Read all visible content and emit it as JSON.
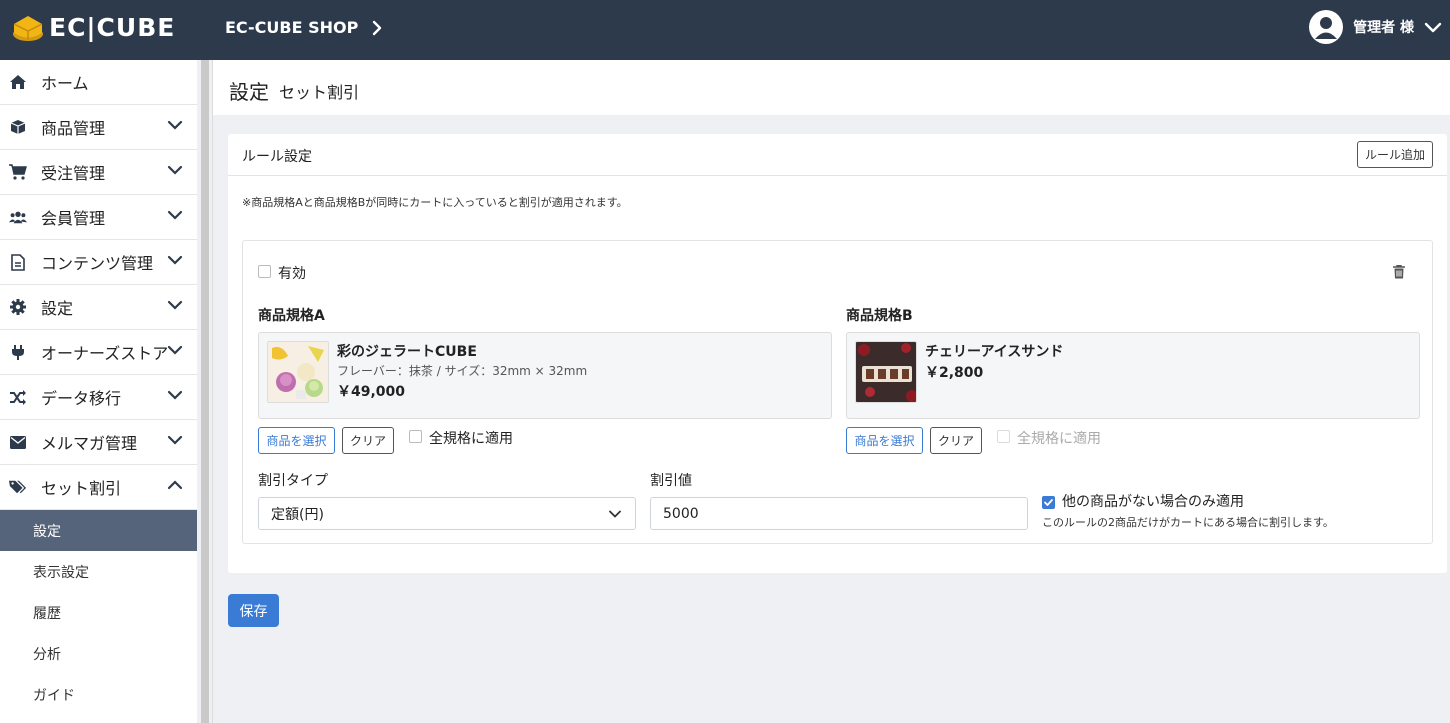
{
  "header": {
    "logo_text": "EC|CUBE",
    "shop_name": "EC-CUBE SHOP",
    "user_label": "管理者 様"
  },
  "sidebar": {
    "items": [
      {
        "label": "ホーム",
        "icon": "home-icon"
      },
      {
        "label": "商品管理",
        "icon": "box-icon"
      },
      {
        "label": "受注管理",
        "icon": "cart-icon"
      },
      {
        "label": "会員管理",
        "icon": "users-icon"
      },
      {
        "label": "コンテンツ管理",
        "icon": "file-icon"
      },
      {
        "label": "設定",
        "icon": "gear-icon"
      },
      {
        "label": "オーナーズストア",
        "icon": "plug-icon"
      },
      {
        "label": "データ移行",
        "icon": "shuffle-icon"
      },
      {
        "label": "メルマガ管理",
        "icon": "envelope-icon"
      },
      {
        "label": "セット割引",
        "icon": "tags-icon"
      }
    ],
    "sub_items": [
      {
        "label": "設定",
        "active": true
      },
      {
        "label": "表示設定"
      },
      {
        "label": "履歴"
      },
      {
        "label": "分析"
      },
      {
        "label": "ガイド"
      }
    ]
  },
  "page": {
    "title": "設定",
    "subtitle": "セット割引"
  },
  "card": {
    "title": "ルール設定",
    "add_rule_label": "ルール追加",
    "note": "※商品規格Aと商品規格Bが同時にカートに入っていると割引が適用されます。"
  },
  "rule": {
    "enabled_label": "有効",
    "enabled": false,
    "product_a": {
      "heading": "商品規格A",
      "name": "彩のジェラートCUBE",
      "variant": "フレーバー：抹茶 / サイズ：32mm × 32mm",
      "price": "￥49,000",
      "select_label": "商品を選択",
      "clear_label": "クリア",
      "apply_all_label": "全規格に適用"
    },
    "product_b": {
      "heading": "商品規格B",
      "name": "チェリーアイスサンド",
      "price": "￥2,800",
      "select_label": "商品を選択",
      "clear_label": "クリア",
      "apply_all_label": "全規格に適用"
    },
    "discount_type_label": "割引タイプ",
    "discount_type_value": "定額(円)",
    "discount_value_label": "割引値",
    "discount_value": "5000",
    "only_label": "他の商品がない場合のみ適用",
    "only_checked": true,
    "only_help": "このルールの2商品だけがカートにある場合に割引します。"
  },
  "save_label": "保存",
  "colors": {
    "header_bg": "#2d3a4b",
    "accent": "#3a7bd5",
    "active_sub_bg": "#55647a"
  }
}
